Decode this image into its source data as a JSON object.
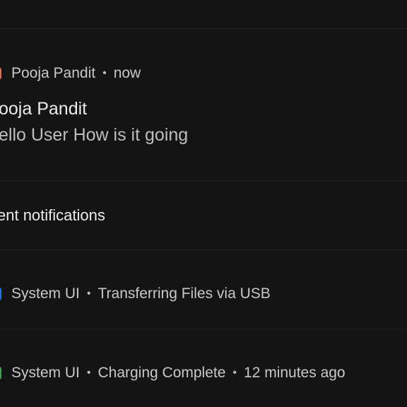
{
  "conversation": {
    "sender": "Pooja Pandit",
    "time": "now",
    "title": "ooja Pandit",
    "message": "ello User How is it going",
    "icon": "avatar-icon",
    "icon_color": "#e0704a"
  },
  "section": {
    "label": "ent notifications"
  },
  "notifications": [
    {
      "app": "System UI",
      "text": "Transferring Files via USB",
      "time": "",
      "icon": "usb-icon",
      "icon_color": "#1a73e8"
    },
    {
      "app": "System UI",
      "text": "Charging Complete",
      "time": "12 minutes ago",
      "icon": "battery-icon",
      "icon_color": "#34a853"
    }
  ],
  "separator": "•"
}
